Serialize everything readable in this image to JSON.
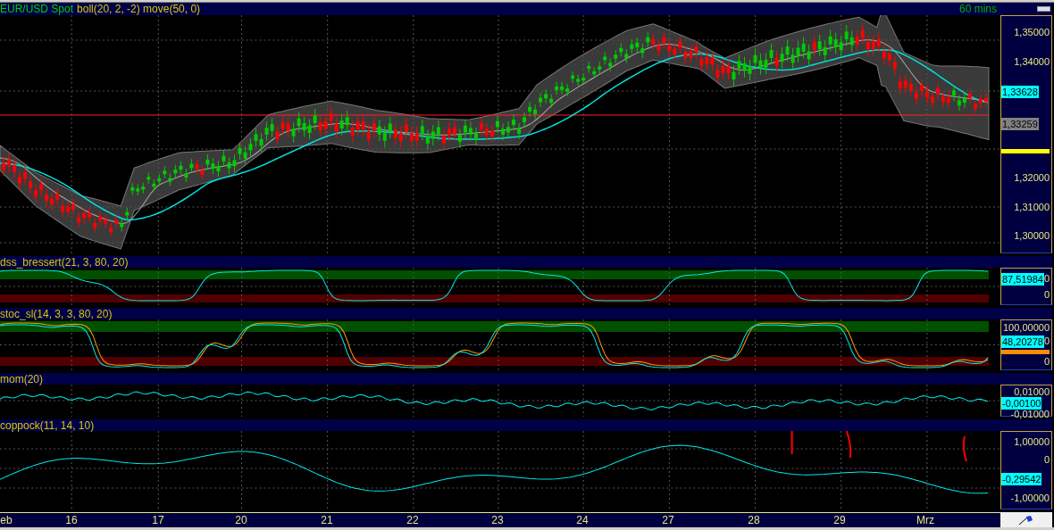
{
  "chart_header": {
    "symbol": "EUR/USD Spot",
    "studies": "boll(20, 2, -2) move(50, 0)",
    "timeframe": "60 mins"
  },
  "price_axis": [
    {
      "kind": "label",
      "text": "1,35000"
    },
    {
      "kind": "label",
      "text": "1,34000"
    },
    {
      "kind": "tag",
      "text": "1,33628",
      "color": "#00ffff"
    },
    {
      "kind": "tag",
      "text": "1,33259",
      "color": "#808080"
    },
    {
      "kind": "bar",
      "color": "#ffff00"
    },
    {
      "kind": "label",
      "text": "1,32000"
    },
    {
      "kind": "label",
      "text": "1,31000"
    },
    {
      "kind": "label",
      "text": "1,30000"
    }
  ],
  "panels": [
    {
      "kind": "dss",
      "title": "dss_bressert(21, 3, 80, 20)",
      "axis": [
        {
          "kind": "tag",
          "text": "87,51984",
          "color": "#00ffff",
          "tail": "0"
        },
        {
          "kind": "label",
          "text": "0"
        }
      ]
    },
    {
      "kind": "stoc",
      "title": "stoc_sl(14, 3, 3, 80, 20)",
      "axis": [
        {
          "kind": "label",
          "text": "100,00000"
        },
        {
          "kind": "tag",
          "text": "48,20278",
          "color": "#00ffff",
          "tail": "0"
        },
        {
          "kind": "bar",
          "color": "#ff8c00"
        },
        {
          "kind": "label",
          "text": "0"
        }
      ]
    },
    {
      "kind": "mom",
      "title": "mom(20)",
      "axis": [
        {
          "kind": "label",
          "text": "0,01000"
        },
        {
          "kind": "tag",
          "text": "-0,00100",
          "color": "#00ffff"
        },
        {
          "kind": "label",
          "text": "-0,01000"
        }
      ]
    },
    {
      "kind": "coppock",
      "title": "coppock(11, 14, 10)",
      "axis": [
        {
          "kind": "label",
          "text": "1,00000"
        },
        {
          "kind": "label",
          "text": "0"
        },
        {
          "kind": "tag",
          "text": "-0,29542",
          "color": "#00ffff"
        },
        {
          "kind": "label",
          "text": "-1,00000"
        }
      ]
    }
  ],
  "time_axis": [
    "eb",
    "16",
    "17",
    "20",
    "21",
    "22",
    "23",
    "24",
    "27",
    "28",
    "29",
    "Mrz"
  ]
}
